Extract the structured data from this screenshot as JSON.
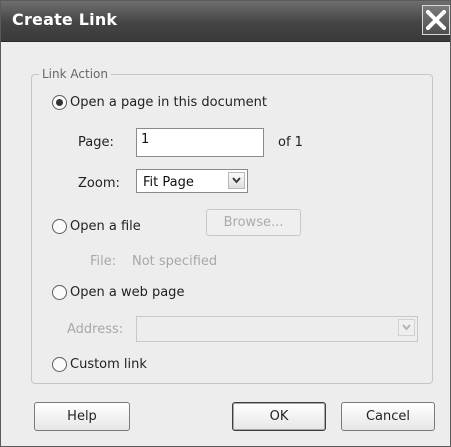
{
  "dialog": {
    "title": "Create Link",
    "close_icon": "close-icon"
  },
  "link_action": {
    "group_label": "Link Action",
    "option_page": "Open a page in this document",
    "page_label": "Page:",
    "page_value": "1",
    "page_of": "of 1",
    "zoom_label": "Zoom:",
    "zoom_value": "Fit Page",
    "option_file": "Open a file",
    "browse_label": "Browse...",
    "file_label": "File:",
    "file_value": "Not specified",
    "option_web": "Open a web page",
    "address_label": "Address:",
    "address_value": "",
    "option_custom": "Custom link",
    "selected_option": "option_page"
  },
  "buttons": {
    "help": "Help",
    "ok": "OK",
    "cancel": "Cancel"
  }
}
